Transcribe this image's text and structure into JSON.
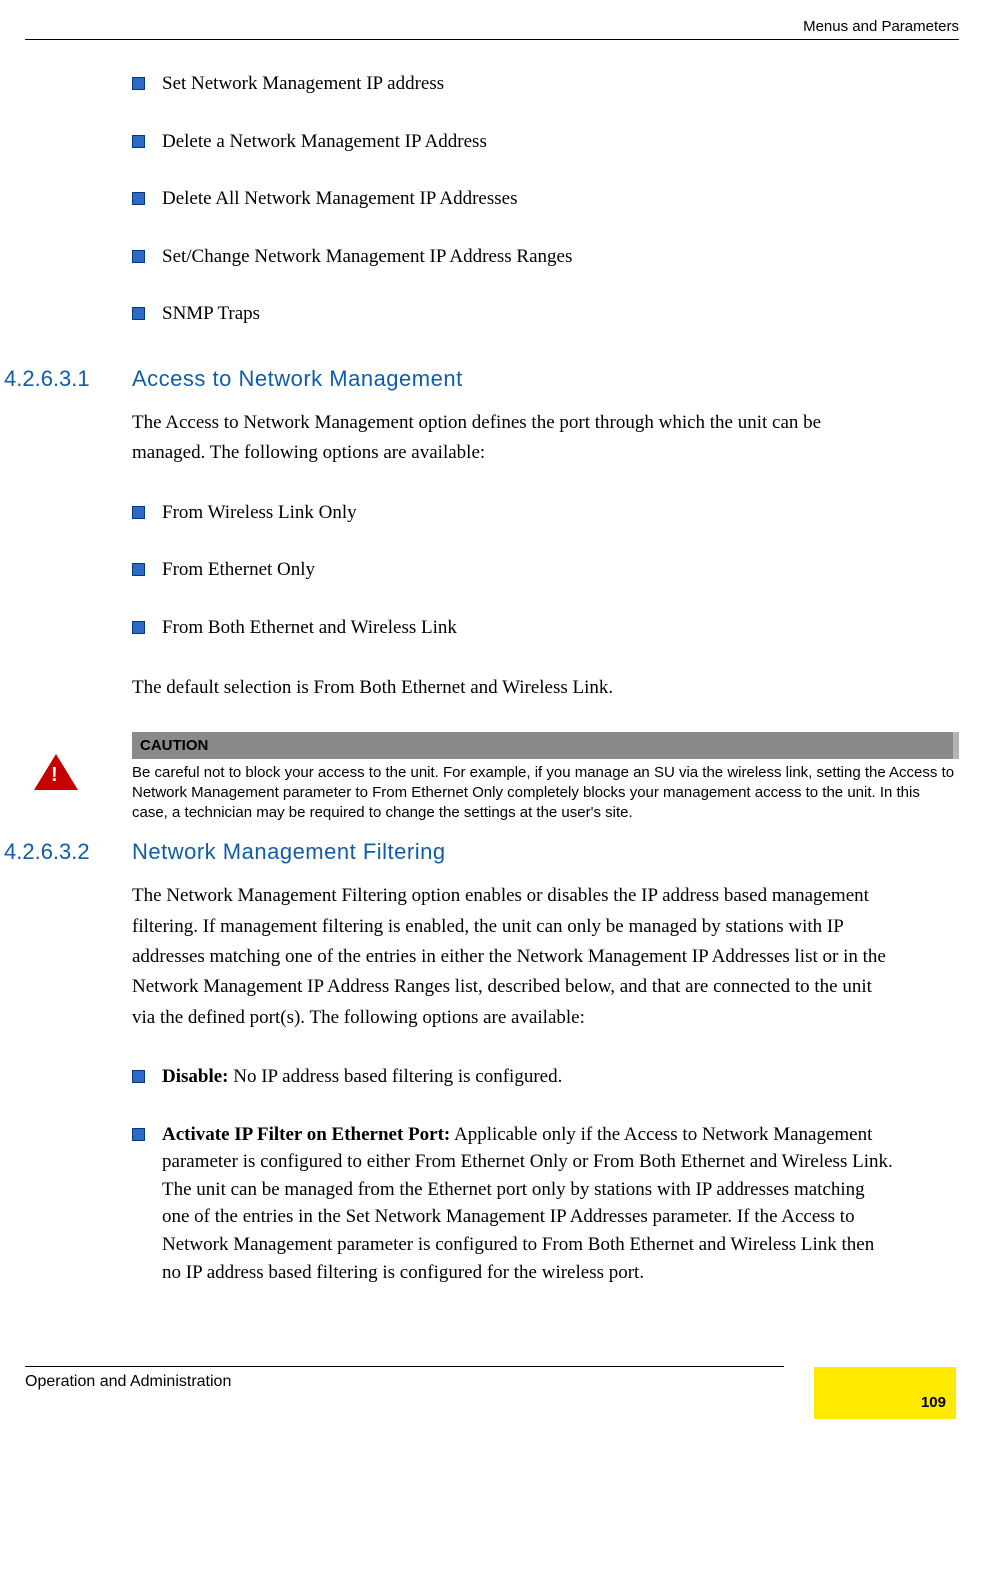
{
  "header": {
    "chapter": "Menus and Parameters"
  },
  "top_list": [
    "Set Network Management IP address",
    "Delete a Network Management IP Address",
    "Delete All Network Management IP Addresses",
    "Set/Change Network Management IP Address Ranges",
    "SNMP Traps"
  ],
  "section1": {
    "num": "4.2.6.3.1",
    "title": "Access to Network Management",
    "intro": "The Access to Network Management option defines the port through which the unit can be managed. The following options are available:",
    "options": [
      "From Wireless Link Only",
      "From Ethernet Only",
      "From Both Ethernet and Wireless Link"
    ],
    "default_text": "The default selection is From Both Ethernet and Wireless Link."
  },
  "caution": {
    "label": "CAUTION",
    "text": "Be careful not to block your access to the unit. For example, if you manage an SU via the wireless link, setting the Access to Network Management parameter to From Ethernet Only completely blocks your management access to the unit. In this case, a technician may be required to change the settings at the user's site."
  },
  "section2": {
    "num": "4.2.6.3.2",
    "title": "Network Management Filtering",
    "intro": "The Network Management Filtering option enables or disables the IP address based management filtering. If management filtering is enabled, the unit can only be managed by stations with IP addresses matching one of the entries in either the Network Management IP Addresses list or in the Network Management IP Address Ranges list, described below, and that are connected to the unit via the defined port(s). The following options are available:",
    "options": [
      {
        "bold": "Disable:",
        "rest": " No IP address based filtering is configured."
      },
      {
        "bold": "Activate IP Filter on Ethernet Port:",
        "rest": " Applicable only if the Access to Network Management parameter is configured to either From Ethernet Only or From Both Ethernet and Wireless Link. The unit can be managed from the Ethernet port only by stations with IP addresses matching one of the entries in the Set Network Management IP Addresses parameter. If the Access to Network Management parameter is configured to From Both Ethernet and Wireless Link then no IP address based filtering is configured for the wireless port."
      }
    ]
  },
  "footer": {
    "doc_title": "Operation and Administration",
    "page": "109"
  }
}
